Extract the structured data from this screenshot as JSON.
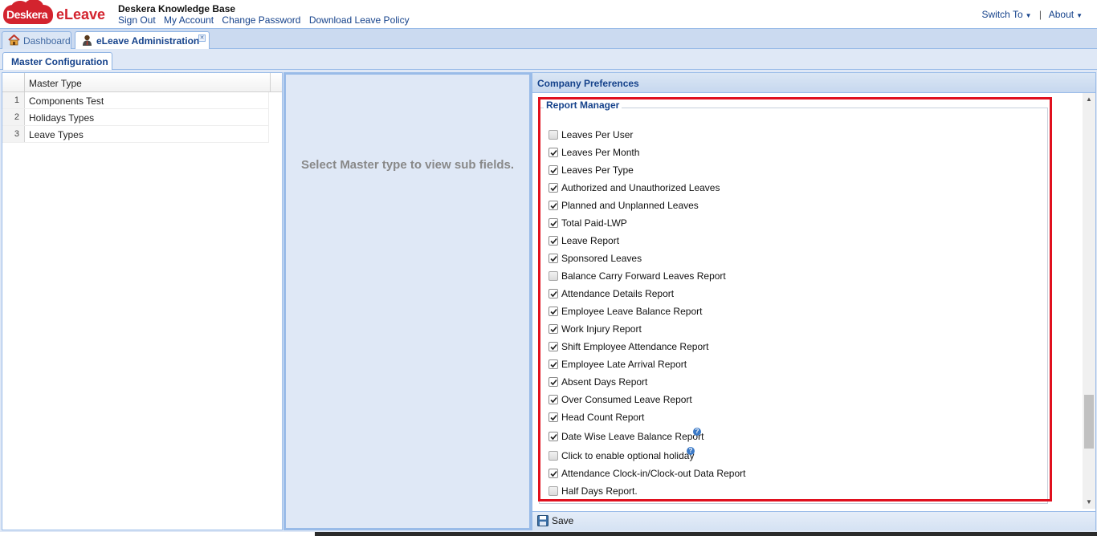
{
  "header": {
    "brand": "Deskera",
    "product": "eLeave",
    "site_title": "Deskera Knowledge Base",
    "links": [
      "Sign Out",
      "My Account",
      "Change Password",
      "Download Leave Policy"
    ],
    "switch_to": "Switch To",
    "about": "About",
    "brand_color": "#d3232e"
  },
  "main_tabs": [
    {
      "label": "Dashboard",
      "icon": "home-icon"
    },
    {
      "label": "eLeave Administration",
      "icon": "admin-user-icon",
      "active": true
    }
  ],
  "sub_tabs": [
    {
      "label": "Master Configuration",
      "active": true
    }
  ],
  "grid": {
    "header": "Master Type",
    "rows": [
      {
        "num": "1",
        "name": "Components Test"
      },
      {
        "num": "2",
        "name": "Holidays Types"
      },
      {
        "num": "3",
        "name": "Leave Types"
      }
    ]
  },
  "middle": {
    "message": "Select Master type to view sub fields."
  },
  "prefs": {
    "title": "Company Preferences",
    "section": "Report Manager",
    "items": [
      {
        "label": "Leaves Per User",
        "checked": false
      },
      {
        "label": "Leaves Per Month",
        "checked": true
      },
      {
        "label": "Leaves Per Type",
        "checked": true
      },
      {
        "label": "Authorized and Unauthorized Leaves",
        "checked": true
      },
      {
        "label": "Planned and Unplanned Leaves",
        "checked": true
      },
      {
        "label": "Total Paid-LWP",
        "checked": true
      },
      {
        "label": "Leave Report",
        "checked": true
      },
      {
        "label": "Sponsored Leaves",
        "checked": true
      },
      {
        "label": "Balance Carry Forward Leaves Report",
        "checked": false
      },
      {
        "label": "Attendance Details Report",
        "checked": true
      },
      {
        "label": "Employee Leave Balance Report",
        "checked": true
      },
      {
        "label": "Work Injury Report",
        "checked": true
      },
      {
        "label": "Shift Employee Attendance Report",
        "checked": true
      },
      {
        "label": "Employee Late Arrival Report",
        "checked": true
      },
      {
        "label": "Absent Days Report",
        "checked": true
      },
      {
        "label": "Over Consumed Leave Report",
        "checked": true
      },
      {
        "label": "Head Count Report",
        "checked": true
      },
      {
        "label": "Date Wise Leave Balance Report",
        "checked": true,
        "help": true
      },
      {
        "label": "Click to enable optional holiday",
        "checked": false,
        "help": true
      },
      {
        "label": "Attendance Clock-in/Clock-out Data Report",
        "checked": true
      },
      {
        "label": "Half Days Report.",
        "checked": false
      }
    ],
    "save_label": "Save",
    "highlight_color": "#e0101e"
  }
}
